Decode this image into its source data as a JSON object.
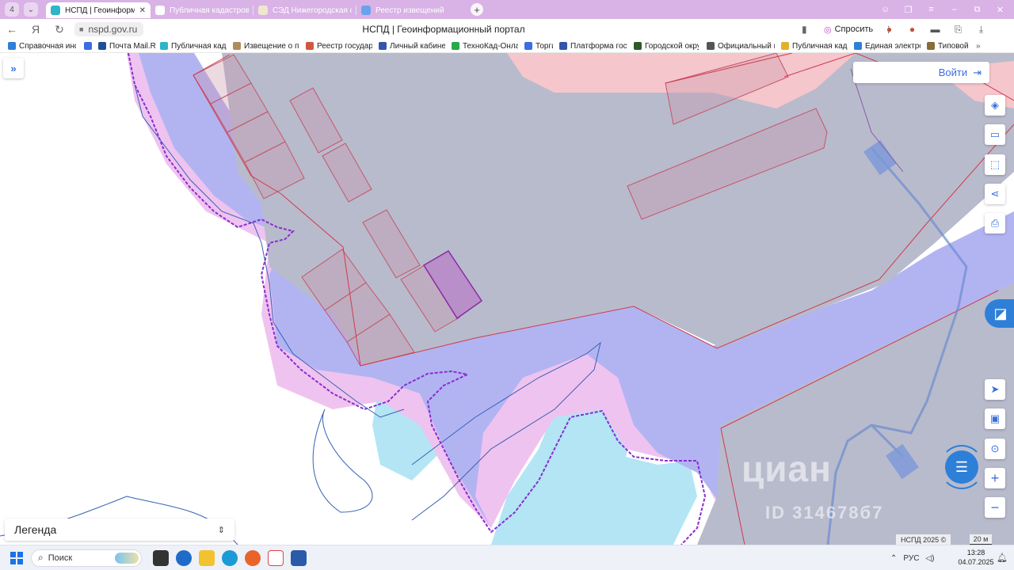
{
  "browser": {
    "tab_counter": "4",
    "tabs": [
      {
        "label": "НСПД | Геоинформаци",
        "active": true,
        "icon_color": "#2fb5c7"
      },
      {
        "label": "Публичная кадастровая",
        "active": false,
        "icon_color": "#ffffff"
      },
      {
        "label": "СЭД Нижегородская обл",
        "active": false,
        "icon_color": "#f0e6d0"
      },
      {
        "label": "Реестр извещений",
        "active": false,
        "icon_color": "#6aa2ee"
      }
    ],
    "new_tab": "+",
    "close_glyph": "✕",
    "address": "nspd.gov.ru",
    "page_title": "НСПД | Геоинформационный портал",
    "ask_label": "Спросить",
    "bookmarks": [
      {
        "label": "Справочная инфо",
        "icon_color": "#2e7fd8"
      },
      {
        "label": "",
        "icon_color": "#3b6ee0"
      },
      {
        "label": "Почта Mail.Ru",
        "icon_color": "#1d4f9a"
      },
      {
        "label": "Публичная кадас",
        "icon_color": "#2fb5c7"
      },
      {
        "label": "Извещение о про",
        "icon_color": "#b08c5a"
      },
      {
        "label": "Реестр государст",
        "icon_color": "#d0583c"
      },
      {
        "label": "Личный кабинет",
        "icon_color": "#3355aa"
      },
      {
        "label": "ТехноКад-Онлай",
        "icon_color": "#2aa84a"
      },
      {
        "label": "Торги",
        "icon_color": "#3b6ee0"
      },
      {
        "label": "Платформа госуд",
        "icon_color": "#3355aa"
      },
      {
        "label": "Городской округ",
        "icon_color": "#2a5c2a"
      },
      {
        "label": "Официальный по",
        "icon_color": "#555555"
      },
      {
        "label": "Публичная кадас",
        "icon_color": "#e0b030"
      },
      {
        "label": "Единая электрон",
        "icon_color": "#2e7fd8"
      },
      {
        "label": "Типовой",
        "icon_color": "#8a6a3a"
      }
    ]
  },
  "map": {
    "login_label": "Войти",
    "legend_label": "Легенда",
    "watermark": "циан",
    "watermark_id": "ID 314678б7",
    "copyright": "НСПД 2025 ©",
    "scale_label": "20 м",
    "colors": {
      "zone_blue": "#b2b4f2",
      "zone_pink": "#efc3ef",
      "zone_gray": "#b8bbcc",
      "water": "#b3e5f5",
      "red_zone": "#f5c6cc",
      "selected_parcel": "#b88fc8",
      "accent": "#2e7fd8"
    }
  },
  "taskbar": {
    "search_label": "Поиск",
    "lang": "РУС",
    "time": "13:28",
    "date": "04.07.2025"
  }
}
